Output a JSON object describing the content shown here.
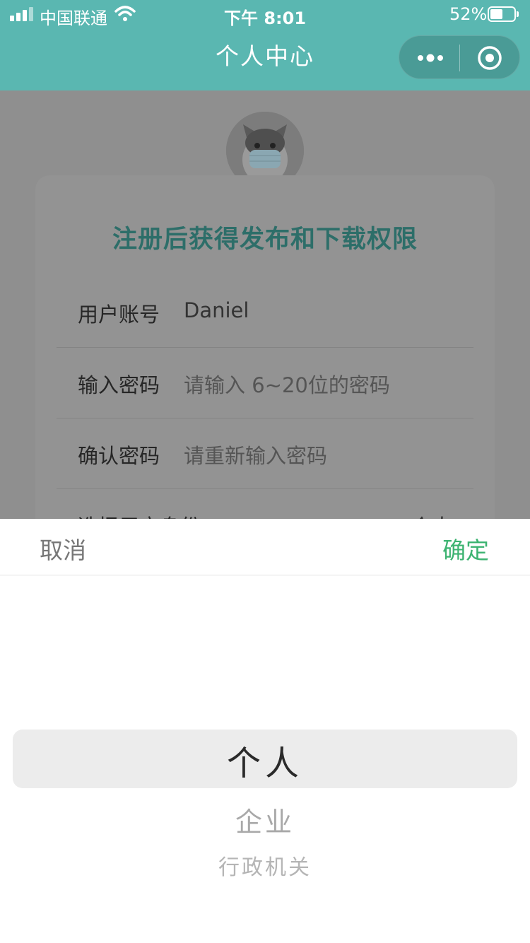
{
  "status_bar": {
    "carrier": "中国联通",
    "time": "下午 8:01",
    "battery": "52%",
    "battery_level": 0.52
  },
  "nav": {
    "title": "个人中心",
    "colors": {
      "nav_bg": "#5ab7b1",
      "capsule_bg": "#4a9b96"
    }
  },
  "card": {
    "title": "注册后获得发布和下载权限",
    "fields": [
      {
        "label": "用户账号",
        "value": "Daniel"
      },
      {
        "label": "输入密码",
        "placeholder": "请输入 6~20位的密码"
      },
      {
        "label": "确认密码",
        "placeholder": "请重新输入密码"
      },
      {
        "label": "选择用户身份",
        "value": "个人"
      }
    ]
  },
  "picker": {
    "cancel_label": "取消",
    "confirm_label": "确定",
    "options": [
      "个人",
      "企业",
      "行政机关"
    ],
    "selected": "个人",
    "confirm_color": "#3cb371"
  }
}
